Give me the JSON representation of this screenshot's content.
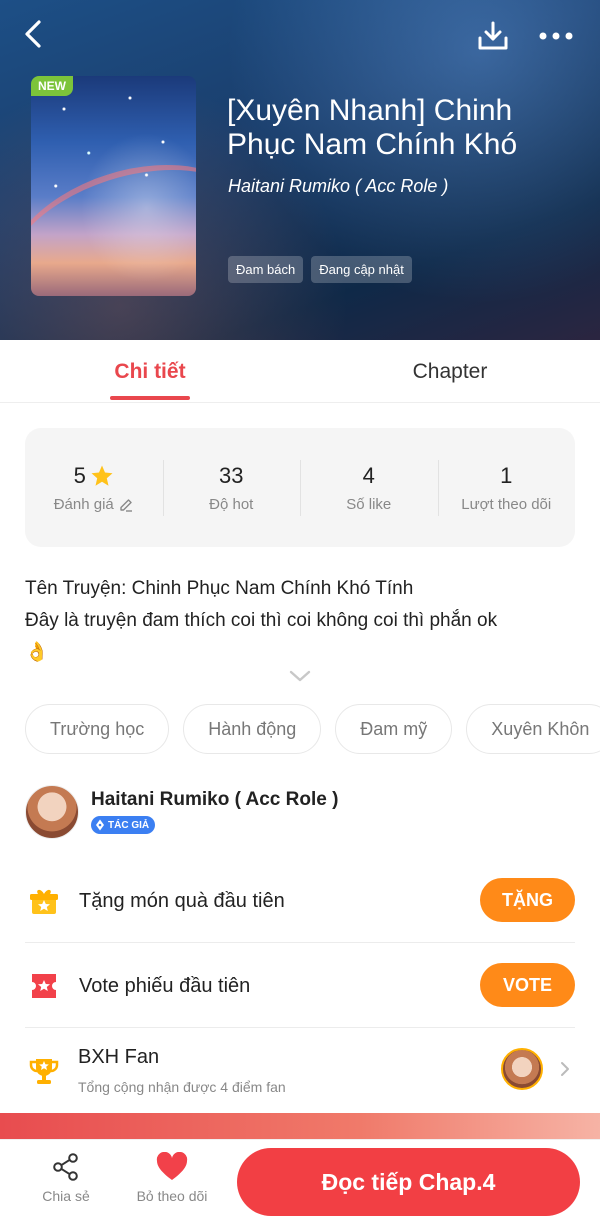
{
  "header": {
    "badge": "NEW",
    "title": "[Xuyên Nhanh] Chinh Phục Nam Chính Khó",
    "author": "Haitani Rumiko ( Acc Role )",
    "tags": [
      "Đam bách",
      "Đang cập nhật"
    ],
    "icons": {
      "back": "chevron-left-icon",
      "download": "download-icon",
      "more": "more-horizontal-icon"
    }
  },
  "tabs": {
    "detail": "Chi tiết",
    "chapter": "Chapter"
  },
  "stats": [
    {
      "value": "5",
      "label": "Đánh giá"
    },
    {
      "value": "33",
      "label": "Độ hot"
    },
    {
      "value": "4",
      "label": "Số like"
    },
    {
      "value": "1",
      "label": "Lượt theo dõi"
    }
  ],
  "description": {
    "line1": "Tên Truyện: Chinh Phục Nam Chính Khó Tính",
    "line2": "Đây là truyện đam thích coi thì coi không coi thì phắn ok",
    "emoji": "👌"
  },
  "genres": [
    "Trường học",
    "Hành động",
    "Đam mỹ",
    "Xuyên Khôn"
  ],
  "author": {
    "name": "Haitani Rumiko ( Acc Role )",
    "badge": "TÁC GIẢ"
  },
  "actions": {
    "gift_label": "Tặng món quà đầu tiên",
    "gift_button": "TẶNG",
    "vote_label": "Vote phiếu đầu tiên",
    "vote_button": "VOTE",
    "fan_title": "BXH Fan",
    "fan_subtitle": "Tổng cộng nhận được 4 điểm fan"
  },
  "bottom_bar": {
    "share": "Chia sẻ",
    "unfollow": "Bỏ theo dõi",
    "read": "Đọc tiếp Chap.4"
  },
  "colors": {
    "accent": "#e9474d",
    "orange": "#ff8a18",
    "read_button": "#f23f44",
    "star": "#ffc21a"
  }
}
